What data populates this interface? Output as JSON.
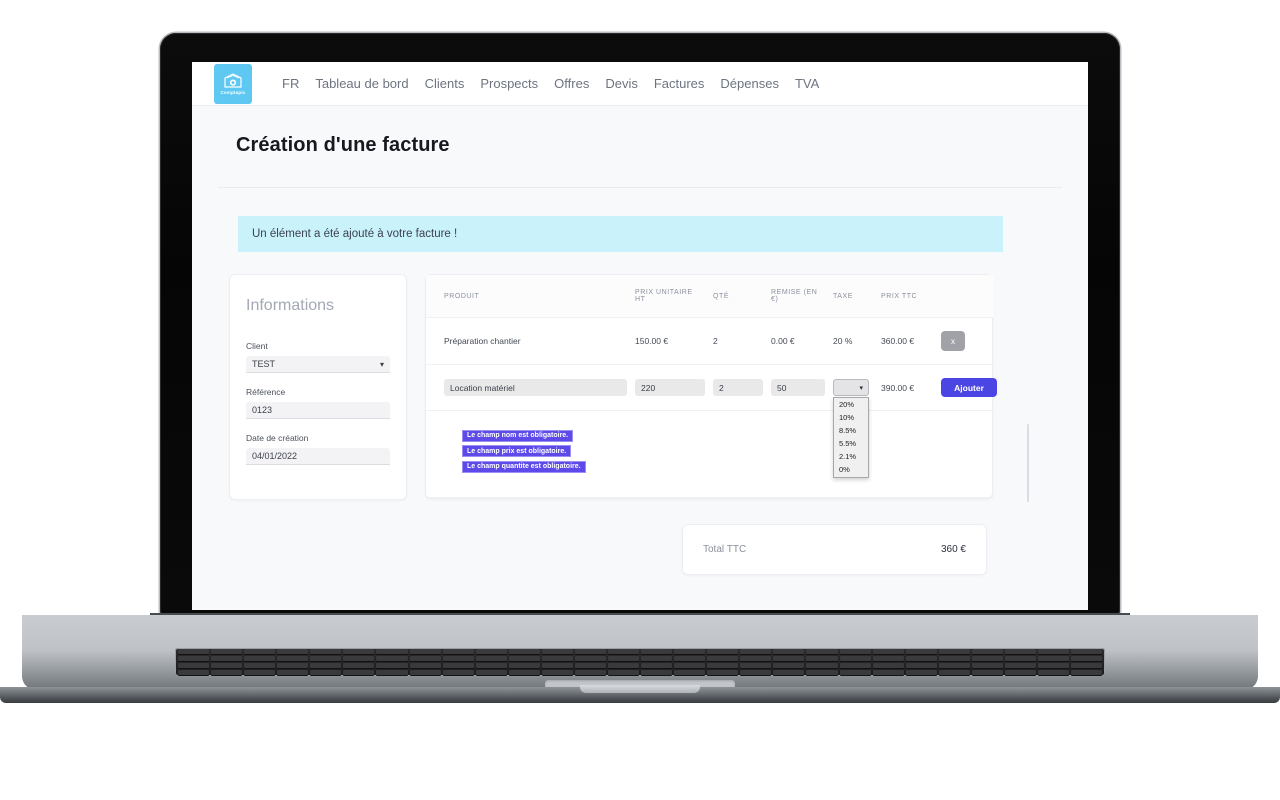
{
  "appbar": {
    "logo_word": "Comptapic",
    "logo_icon": "wallet-icon",
    "nav": [
      {
        "label": "FR"
      },
      {
        "label": "Tableau de bord"
      },
      {
        "label": "Clients"
      },
      {
        "label": "Prospects"
      },
      {
        "label": "Offres"
      },
      {
        "label": "Devis"
      },
      {
        "label": "Factures"
      },
      {
        "label": "Dépenses"
      },
      {
        "label": "TVA"
      }
    ]
  },
  "page": {
    "title": "Création d'une facture",
    "alert": "Un élément a été ajouté à votre facture !"
  },
  "info_panel": {
    "heading": "Informations",
    "client": {
      "label": "Client",
      "value": "TEST"
    },
    "reference": {
      "label": "Référence",
      "value": "0123"
    },
    "date": {
      "label": "Date de création",
      "value": "04/01/2022"
    }
  },
  "items_table": {
    "columns": [
      "PRODUIT",
      "PRIX UNITAIRE HT",
      "QTÉ",
      "REMISE (EN €)",
      "TAXE",
      "PRIX TTC",
      ""
    ],
    "rows": [
      {
        "produit": "Préparation chantier",
        "prix_unitaire_ht": "150.00 €",
        "qte": "2",
        "remise": "0.00 €",
        "taxe": "20 %",
        "prix_ttc": "360.00 €",
        "remove_label": "x"
      }
    ],
    "new_row": {
      "produit_value": "Location matériel",
      "prix_value": "220",
      "qte_value": "2",
      "remise_value": "50",
      "taxe_selected": "",
      "taxe_options": [
        "20%",
        "10%",
        "8.5%",
        "5.5%",
        "2.1%",
        "0%"
      ],
      "prix_ttc": "390.00 €",
      "add_label": "Ajouter"
    },
    "errors": [
      "Le champ nom est obligatoire.",
      "Le champ prix est obligatoire.",
      "Le champ quantite est obligatoire."
    ]
  },
  "total_card": {
    "label": "Total TTC",
    "value": "360 €"
  },
  "colors": {
    "brand": "#5fc8f2",
    "accent": "#4b45e4",
    "alert_bg": "#c9f2fb",
    "error_bg": "#5d4ae8",
    "page_bg": "#f8f9fb"
  }
}
